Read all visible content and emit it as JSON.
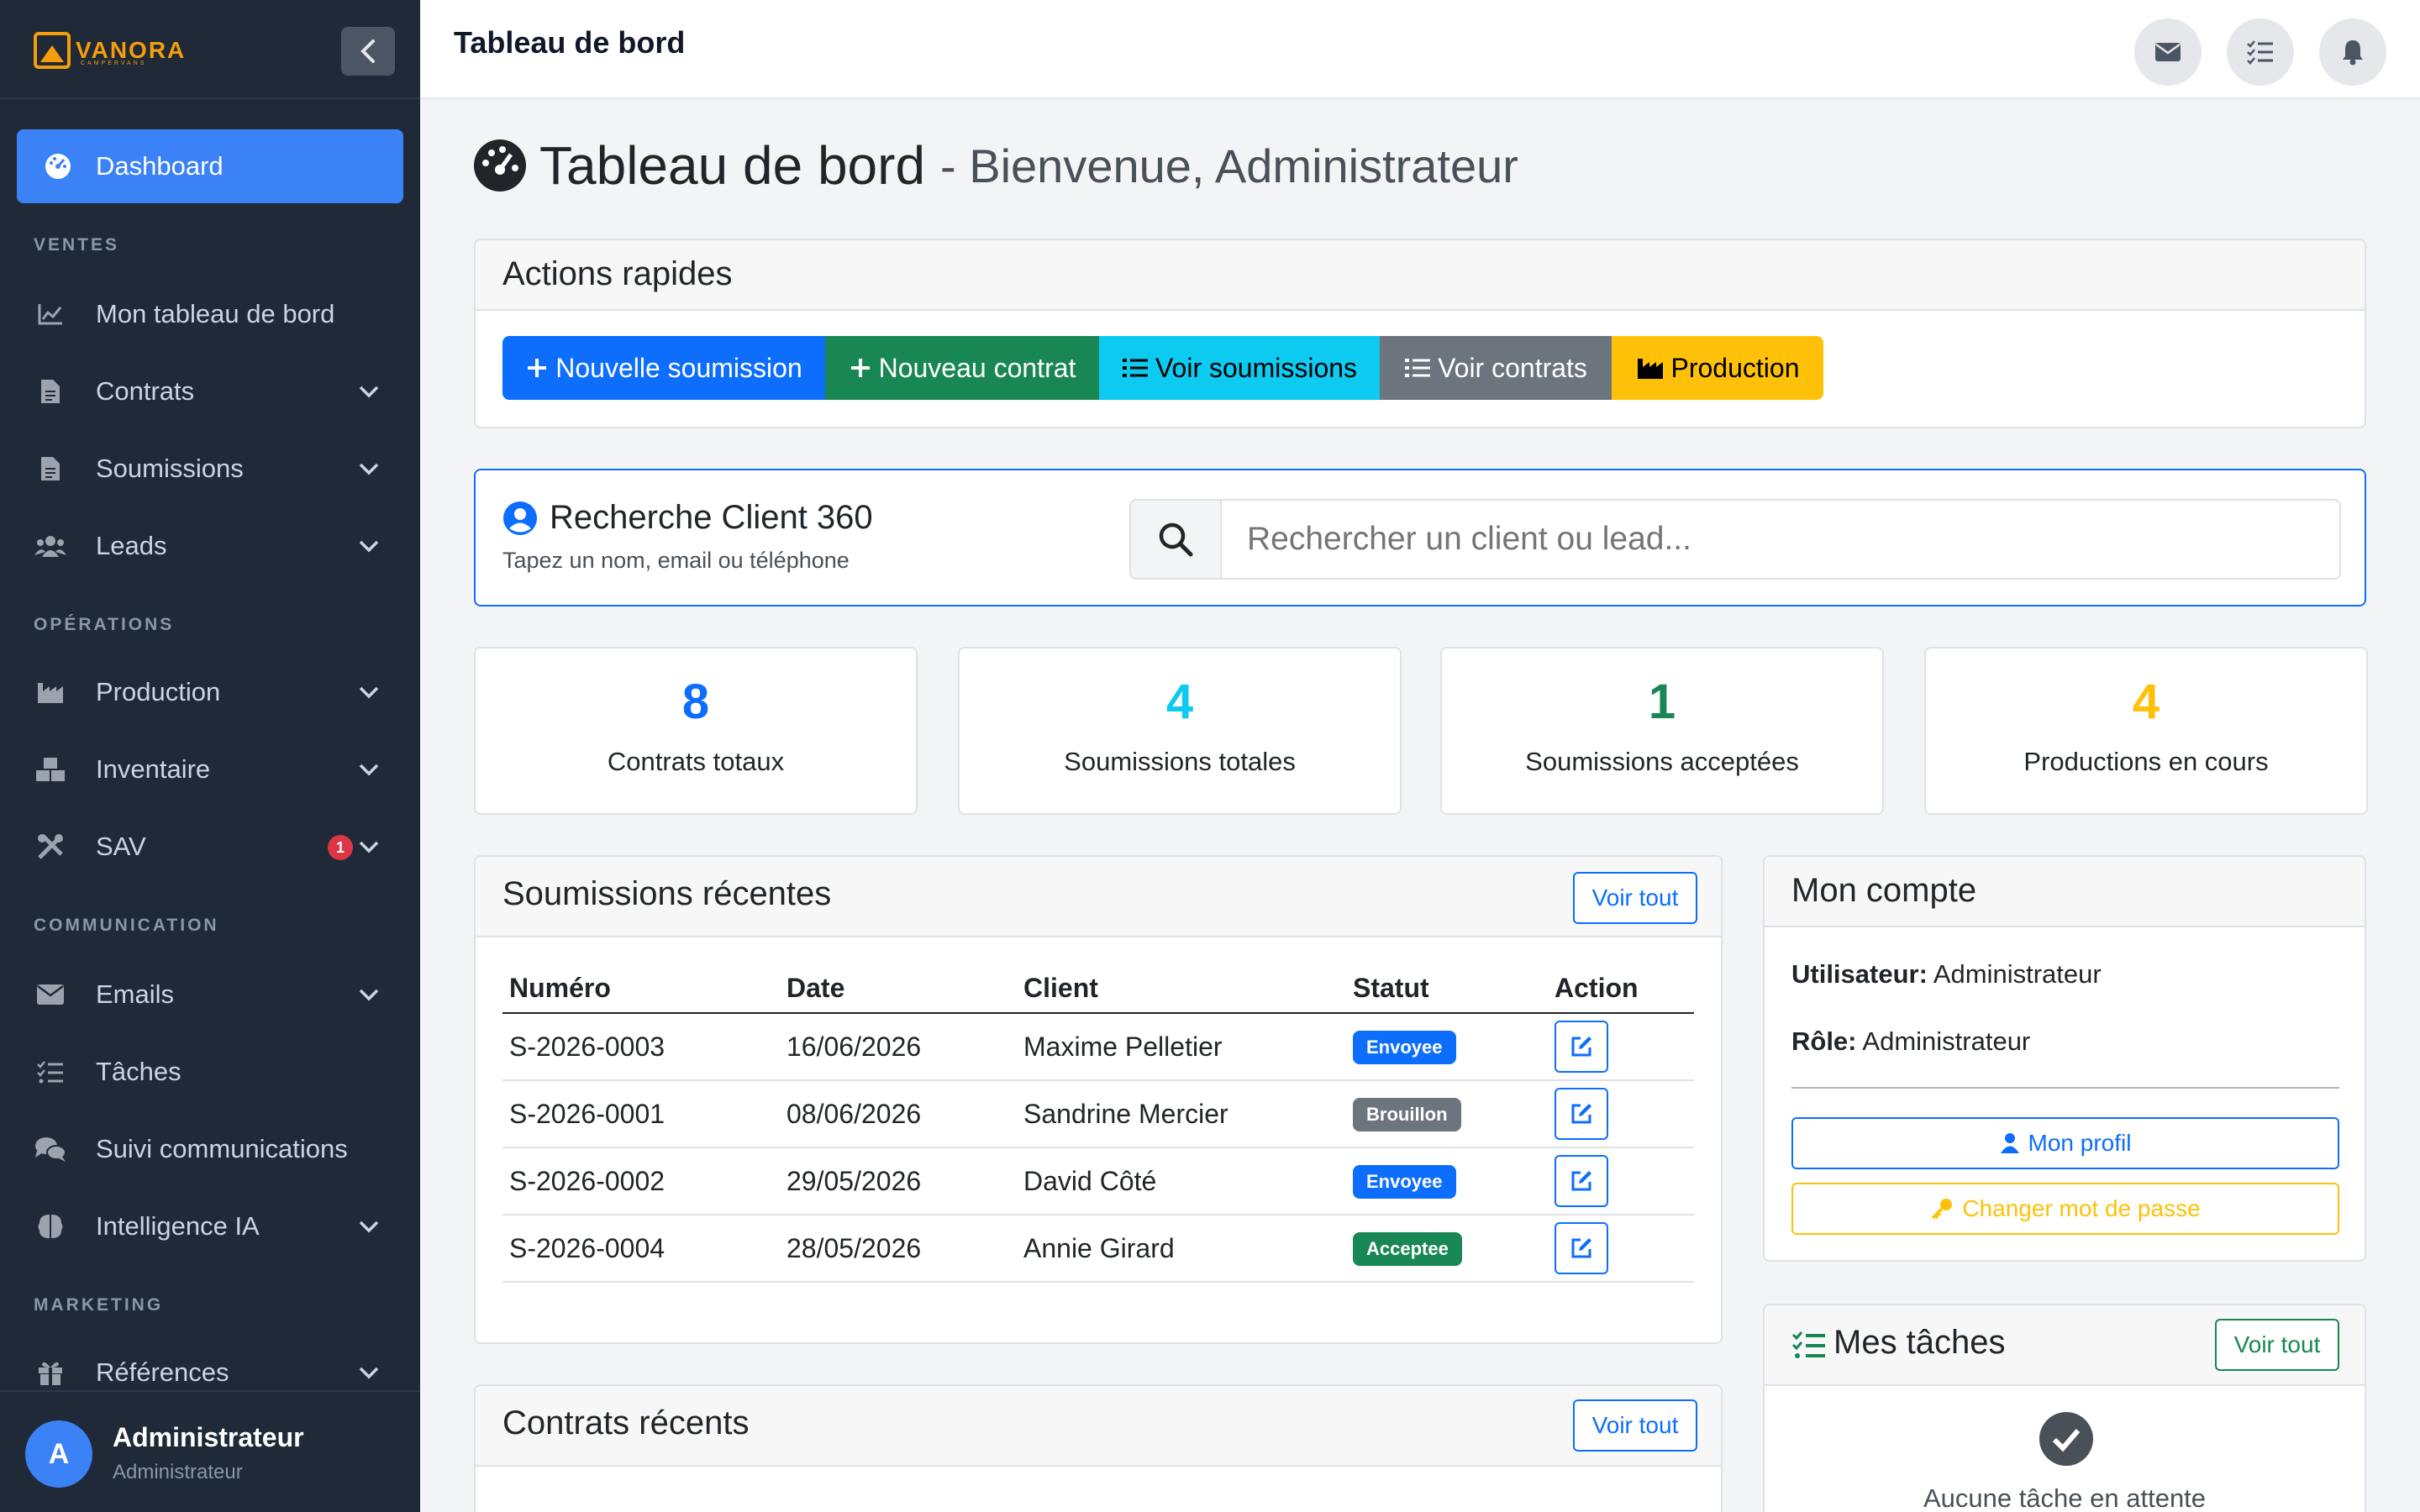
{
  "brand": {
    "name": "VANORA",
    "tagline": "CAMPERVANS"
  },
  "sidebar": {
    "active": {
      "label": "Dashboard"
    },
    "sections": [
      "VENTES",
      "OPÉRATIONS",
      "COMMUNICATION",
      "MARKETING"
    ],
    "items": [
      {
        "label": "Mon tableau de bord",
        "icon": "chart-line-icon"
      },
      {
        "label": "Contrats",
        "icon": "file-icon"
      },
      {
        "label": "Soumissions",
        "icon": "file-icon"
      },
      {
        "label": "Leads",
        "icon": "users-icon"
      },
      {
        "label": "Production",
        "icon": "industry-icon"
      },
      {
        "label": "Inventaire",
        "icon": "boxes-icon"
      },
      {
        "label": "SAV",
        "icon": "tools-icon",
        "badge": "1"
      },
      {
        "label": "Emails",
        "icon": "envelope-icon"
      },
      {
        "label": "Tâches",
        "icon": "tasks-icon"
      },
      {
        "label": "Suivi communications",
        "icon": "comments-icon"
      },
      {
        "label": "Intelligence IA",
        "icon": "brain-icon"
      },
      {
        "label": "Références",
        "icon": "gift-icon"
      }
    ],
    "user": {
      "initial": "A",
      "name": "Administrateur",
      "role": "Administrateur"
    }
  },
  "topbar": {
    "title": "Tableau de bord"
  },
  "page": {
    "title": "Tableau de bord",
    "subtitle": "- Bienvenue, Administrateur"
  },
  "quick_actions": {
    "title": "Actions rapides",
    "buttons": [
      {
        "label": "Nouvelle soumission",
        "color": "#0d6efd"
      },
      {
        "label": "Nouveau contrat",
        "color": "#198754"
      },
      {
        "label": "Voir soumissions",
        "color": "#0dcaf0"
      },
      {
        "label": "Voir contrats",
        "color": "#6c757d"
      },
      {
        "label": "Production",
        "color": "#ffc107"
      }
    ]
  },
  "search": {
    "title": "Recherche Client 360",
    "hint": "Tapez un nom, email ou téléphone",
    "placeholder": "Rechercher un client ou lead..."
  },
  "stats": [
    {
      "value": "8",
      "label": "Contrats totaux",
      "color": "#0d6efd"
    },
    {
      "value": "4",
      "label": "Soumissions totales",
      "color": "#0dcaf0"
    },
    {
      "value": "1",
      "label": "Soumissions acceptées",
      "color": "#198754"
    },
    {
      "value": "4",
      "label": "Productions en cours",
      "color": "#ffc107"
    }
  ],
  "recent_quotes": {
    "title": "Soumissions récentes",
    "view_all": "Voir tout",
    "columns": [
      "Numéro",
      "Date",
      "Client",
      "Statut",
      "Action"
    ],
    "rows": [
      {
        "num": "S-2026-0003",
        "date": "16/06/2026",
        "client": "Maxime Pelletier",
        "status": "Envoyee",
        "status_color": "#0d6efd"
      },
      {
        "num": "S-2026-0001",
        "date": "08/06/2026",
        "client": "Sandrine Mercier",
        "status": "Brouillon",
        "status_color": "#6c757d"
      },
      {
        "num": "S-2026-0002",
        "date": "29/05/2026",
        "client": "David Côté",
        "status": "Envoyee",
        "status_color": "#0d6efd"
      },
      {
        "num": "S-2026-0004",
        "date": "28/05/2026",
        "client": "Annie Girard",
        "status": "Acceptee",
        "status_color": "#198754"
      }
    ]
  },
  "recent_contracts": {
    "title": "Contrats récents",
    "view_all": "Voir tout"
  },
  "account": {
    "title": "Mon compte",
    "user_label": "Utilisateur:",
    "user_value": "Administrateur",
    "role_label": "Rôle:",
    "role_value": "Administrateur",
    "profile_btn": "Mon profil",
    "password_btn": "Changer mot de passe"
  },
  "tasks": {
    "title": "Mes tâches",
    "view_all": "Voir tout",
    "empty": "Aucune tâche en attente"
  }
}
